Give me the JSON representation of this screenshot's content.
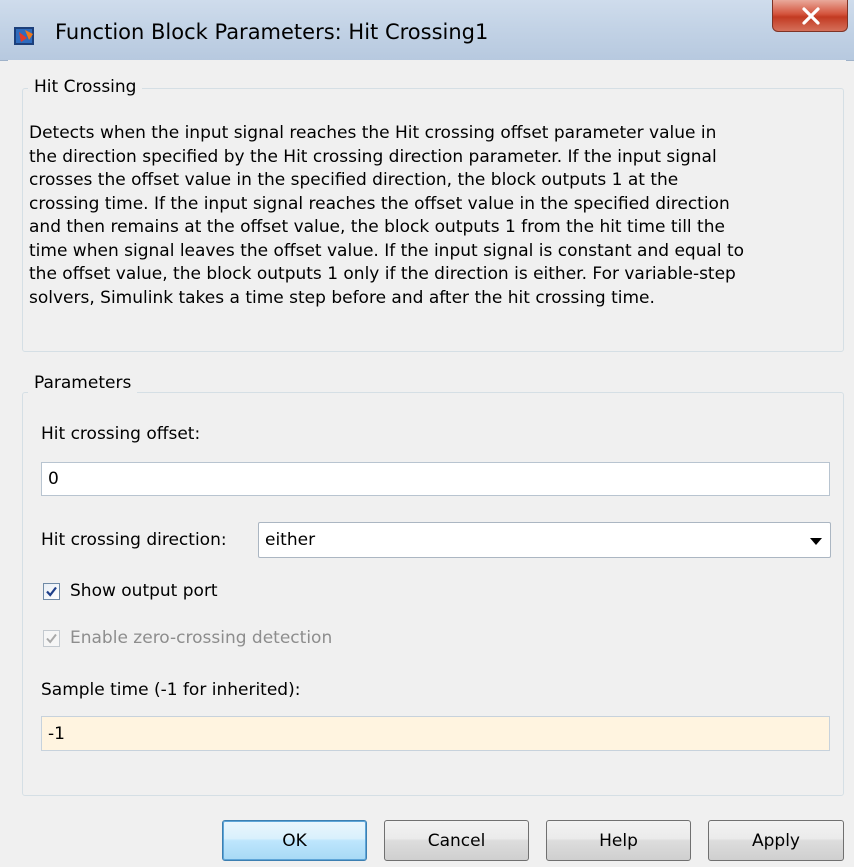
{
  "window": {
    "title": "Function Block Parameters: Hit Crossing1",
    "close_label": "X"
  },
  "block_group": {
    "label": "Hit Crossing",
    "description_lines": [
      "Detects when the input signal reaches the Hit crossing offset parameter value in",
      "the direction specified by the Hit crossing direction parameter. If the input signal",
      "crosses the offset value in the specified direction, the block outputs 1 at the",
      "crossing time. If the input signal reaches the offset value in the specified direction",
      "and then remains at the offset value, the block outputs 1 from the hit time till the",
      "time when signal leaves the offset value. If the input signal is constant and equal to",
      "the offset value, the block outputs 1 only if the direction is either. For variable-step",
      "solvers, Simulink takes a time step before and after the hit crossing time."
    ]
  },
  "parameters": {
    "label": "Parameters",
    "offset_label": "Hit crossing offset:",
    "offset_value": "0",
    "direction_label": "Hit crossing direction:",
    "direction_value": "either",
    "show_output_port_label": "Show output port",
    "show_output_port_checked": true,
    "zero_crossing_label": "Enable zero-crossing detection",
    "zero_crossing_checked": true,
    "zero_crossing_enabled": false,
    "sample_time_label": "Sample time (-1 for inherited):",
    "sample_time_value": "-1"
  },
  "buttons": {
    "ok": "OK",
    "cancel": "Cancel",
    "help": "Help",
    "apply": "Apply"
  },
  "icons": {
    "app": "simulink-block-icon",
    "close": "close-icon",
    "dropdown": "chevron-down-icon",
    "check": "checkmark-icon"
  }
}
